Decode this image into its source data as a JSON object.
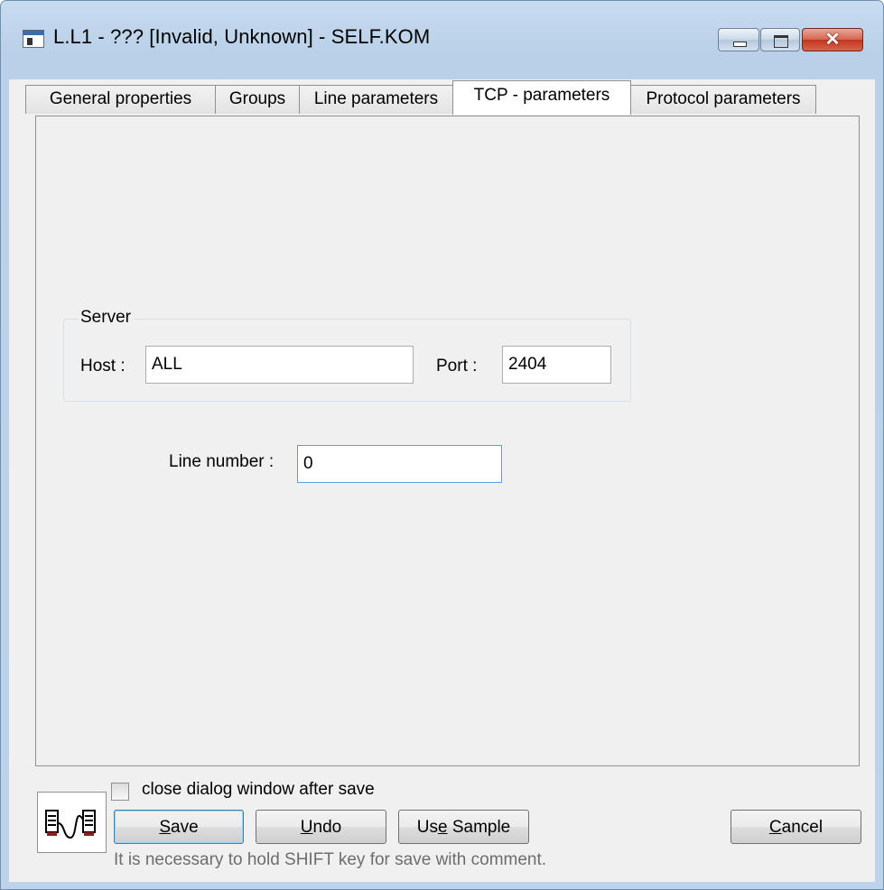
{
  "window": {
    "title": "L.L1 - ??? [Invalid, Unknown] - SELF.KOM",
    "icons": {
      "app": "app-window-icon",
      "minimize": "minimize-icon",
      "maximize": "maximize-icon",
      "close": "close-icon"
    }
  },
  "tabs": [
    {
      "label": "General properties",
      "active": false
    },
    {
      "label": "Groups",
      "active": false
    },
    {
      "label": "Line parameters",
      "active": false
    },
    {
      "label": "TCP - parameters",
      "active": true
    },
    {
      "label": "Protocol parameters",
      "active": false
    }
  ],
  "server": {
    "legend": "Server",
    "host_label": "Host :",
    "host_value": "ALL",
    "port_label": "Port :",
    "port_value": "2404"
  },
  "line": {
    "label": "Line number :",
    "value": "0"
  },
  "footer": {
    "close_after_save_label": "close dialog window after save",
    "close_after_save_checked": false,
    "save_label": "Save",
    "save_accel": "S",
    "undo_label": "Undo",
    "undo_accel": "U",
    "use_sample_label_pre": "Us",
    "use_sample_accel": "e",
    "use_sample_label_post": " Sample",
    "cancel_label": "Cancel",
    "cancel_accel": "C",
    "hint": "It is necessary to hold SHIFT key for save with comment.",
    "logo_icon": "line-connection-icon"
  }
}
